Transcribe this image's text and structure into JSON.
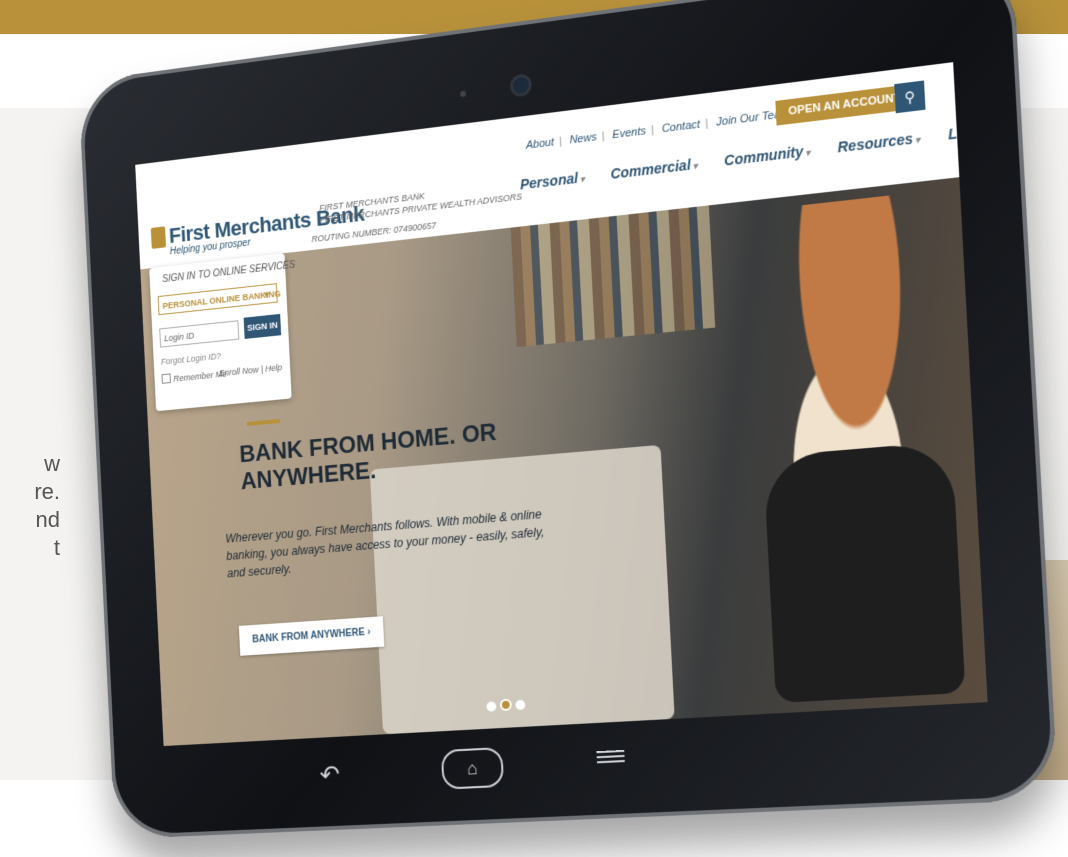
{
  "background": {
    "text_lines": [
      "w",
      "re.",
      "nd",
      "t"
    ]
  },
  "site": {
    "brand": {
      "name": "First Merchants Bank",
      "tagline": "Helping you prosper"
    },
    "sub_links": [
      "FIRST MERCHANTS BANK",
      "FIRST MERCHANTS PRIVATE WEALTH ADVISORS"
    ],
    "routing": "ROUTING NUMBER: 074900657",
    "utility_links": [
      "About",
      "News",
      "Events",
      "Contact",
      "Join Our Team"
    ],
    "open_account_label": "OPEN AN ACCOUNT",
    "main_nav": [
      {
        "label": "Personal"
      },
      {
        "label": "Commercial"
      },
      {
        "label": "Community"
      },
      {
        "label": "Resources"
      },
      {
        "label": "Locations"
      }
    ],
    "signin": {
      "title": "SIGN IN TO ONLINE SERVICES",
      "selected_service": "PERSONAL ONLINE BANKING",
      "login_placeholder": "Login ID",
      "signin_label": "SIGN IN",
      "forgot": "Forgot Login ID?",
      "remember": "Remember Me",
      "enroll": "Enroll Now",
      "help": "Help"
    },
    "hero": {
      "headline": "BANK FROM HOME. OR ANYWHERE.",
      "body": "Wherever you go. First Merchants follows. With mobile & online banking, you always have access to your money - easily, safely, and securely.",
      "cta": "BANK FROM ANYWHERE",
      "carousel_active_index": 1,
      "carousel_count": 3
    }
  },
  "colors": {
    "gold": "#b8913a",
    "navy": "#2f5674"
  }
}
